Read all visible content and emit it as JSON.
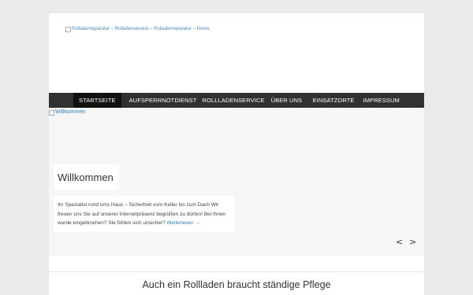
{
  "header": {
    "logo_alt": "Rolladenreparatur – Rolladenservice – Rolladenreparatur – Home"
  },
  "nav": {
    "items": [
      {
        "label": "Startseite",
        "active": true
      },
      {
        "label": "Aufsperrnotdienst"
      },
      {
        "label": "Rollladenservice"
      },
      {
        "label": "Über uns"
      },
      {
        "label": "Einsatzorte"
      },
      {
        "label": "Impressum"
      }
    ]
  },
  "slider": {
    "image_alt": "Willkommen",
    "title": "Willkommen",
    "text": "Ihr Spezialist rund ums Haus – Sicherheit vom Keller bis zum Dach Wir freuen uns Sie auf unserer Internetpräsenz begrüßen zu dürfen! Bei Ihnen wurde eingebrochen? Sie fühlen sich unsicher?",
    "read_more": "Weiterlesen →",
    "prev_symbol": "<",
    "next_symbol": ">"
  },
  "section": {
    "title": "Auch ein Rollladen braucht ständige Pflege"
  }
}
